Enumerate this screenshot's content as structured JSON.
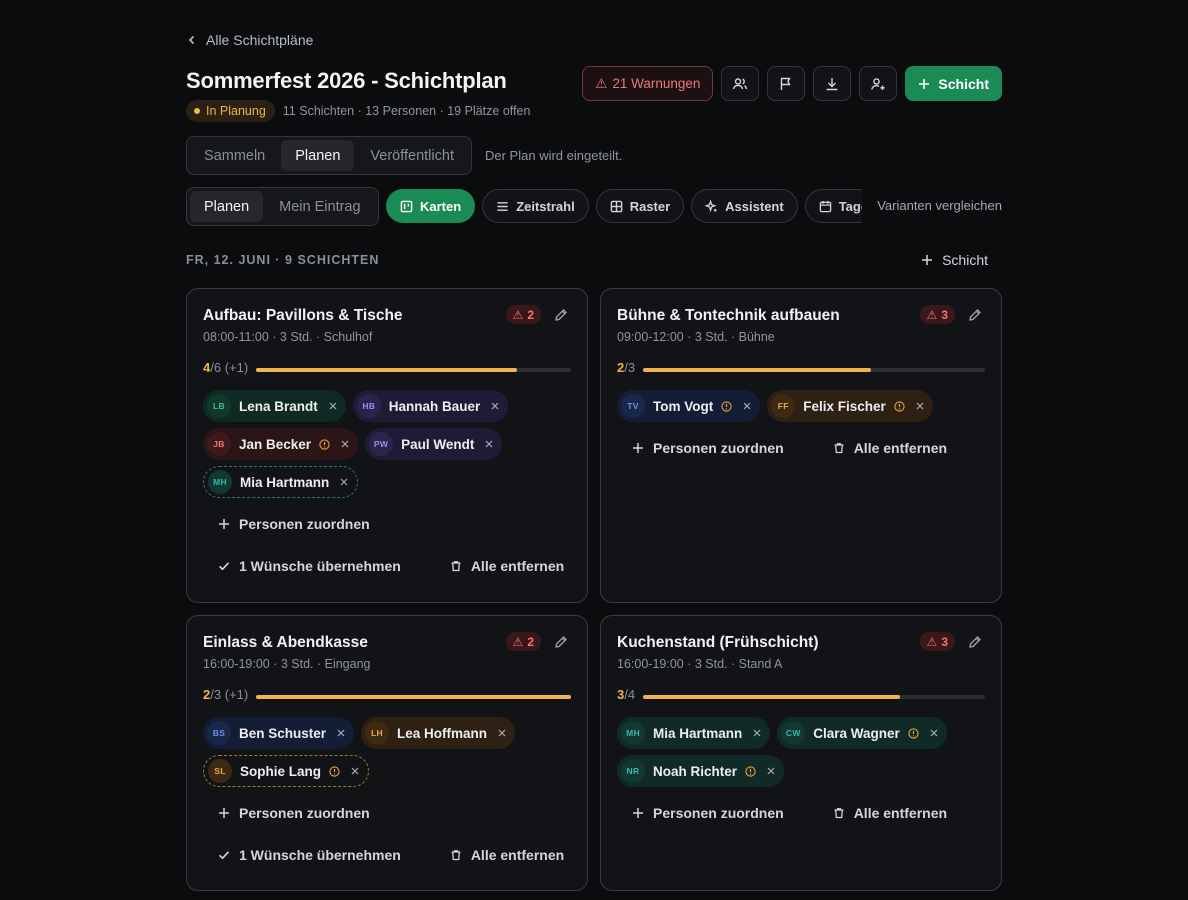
{
  "breadcrumb": {
    "back_label": "Alle Schichtpläne"
  },
  "header": {
    "title": "Sommerfest 2026 - Schichtplan",
    "status": "In Planung",
    "summary": "11 Schichten · 13 Personen · 19 Plätze offen",
    "warnings_label": "21 Warnungen",
    "add_shift_label": "Schicht"
  },
  "phases": {
    "items": [
      "Sammeln",
      "Planen",
      "Veröffentlicht"
    ],
    "active": "Planen",
    "note": "Der Plan wird eingeteilt."
  },
  "modes": {
    "items": [
      "Planen",
      "Mein Eintrag"
    ],
    "active": "Planen"
  },
  "views": {
    "items": [
      {
        "label": "Karten",
        "icon": "kanban-icon"
      },
      {
        "label": "Zeitstrahl",
        "icon": "lines-icon"
      },
      {
        "label": "Raster",
        "icon": "grid-icon"
      },
      {
        "label": "Assistent",
        "icon": "sparkle-icon"
      },
      {
        "label": "Tagesansicht",
        "icon": "calendar-icon"
      }
    ],
    "active": "Karten",
    "compare_label": "Varianten vergleichen"
  },
  "day": {
    "heading": "FR, 12. JUNI · 9 SCHICHTEN",
    "add_label": "Schicht"
  },
  "labels": {
    "assign": "Personen zuordnen",
    "accept_wishes": "1 Wünsche übernehmen",
    "remove_all": "Alle entfernen"
  },
  "shifts": [
    {
      "title": "Aufbau: Pavillons & Tische",
      "subtitle": "08:00-11:00 · 3 Std. · Schulhof",
      "warnings": "2",
      "filled": "4",
      "capacity": "/6 (+1)",
      "progress": 0.83,
      "people": [
        {
          "initials": "LB",
          "name": "Lena Brandt",
          "color": "green",
          "info": false,
          "dashed": false
        },
        {
          "initials": "HB",
          "name": "Hannah Bauer",
          "color": "purple",
          "info": false,
          "dashed": false
        },
        {
          "initials": "JB",
          "name": "Jan Becker",
          "color": "red",
          "info": true,
          "dashed": false
        },
        {
          "initials": "PW",
          "name": "Paul Wendt",
          "color": "purple",
          "info": false,
          "dashed": false
        },
        {
          "initials": "MH",
          "name": "Mia Hartmann",
          "color": "teal",
          "info": false,
          "dashed": true
        }
      ],
      "wishes": true
    },
    {
      "title": "Bühne & Tontechnik aufbauen",
      "subtitle": "09:00-12:00 · 3 Std. · Bühne",
      "warnings": "3",
      "filled": "2",
      "capacity": "/3",
      "progress": 0.667,
      "people": [
        {
          "initials": "TV",
          "name": "Tom Vogt",
          "color": "blue",
          "info": true,
          "dashed": false
        },
        {
          "initials": "FF",
          "name": "Felix Fischer",
          "color": "orange",
          "info": true,
          "dashed": false
        }
      ],
      "wishes": false
    },
    {
      "title": "Einlass & Abendkasse",
      "subtitle": "16:00-19:00 · 3 Std. · Eingang",
      "warnings": "2",
      "filled": "2",
      "capacity": "/3 (+1)",
      "progress": 1.0,
      "people": [
        {
          "initials": "BS",
          "name": "Ben Schuster",
          "color": "blue",
          "info": false,
          "dashed": false
        },
        {
          "initials": "LH",
          "name": "Lea Hoffmann",
          "color": "orange",
          "info": false,
          "dashed": false
        },
        {
          "initials": "SL",
          "name": "Sophie Lang",
          "color": "orange",
          "info": true,
          "dashed": true
        }
      ],
      "wishes": true
    },
    {
      "title": "Kuchenstand (Frühschicht)",
      "subtitle": "16:00-19:00 · 3 Std. · Stand A",
      "warnings": "3",
      "filled": "3",
      "capacity": "/4",
      "progress": 0.75,
      "people": [
        {
          "initials": "MH",
          "name": "Mia Hartmann",
          "color": "teal",
          "info": false,
          "dashed": false
        },
        {
          "initials": "CW",
          "name": "Clara Wagner",
          "color": "teal",
          "info": true,
          "dashed": false
        },
        {
          "initials": "NR",
          "name": "Noah Richter",
          "color": "teal",
          "info": true,
          "dashed": false
        }
      ],
      "wishes": false
    }
  ],
  "colors": {
    "accent": "#1b8b56",
    "warning": "#ef7775",
    "progress": "#f0b44c"
  }
}
